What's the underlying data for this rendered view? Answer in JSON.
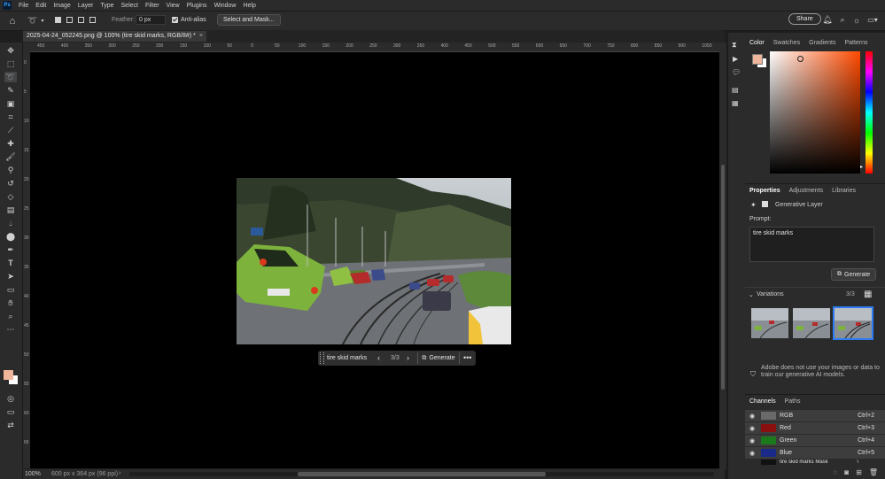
{
  "app": {
    "logo": "Ps"
  },
  "menu": [
    "File",
    "Edit",
    "Image",
    "Layer",
    "Type",
    "Select",
    "Filter",
    "View",
    "Plugins",
    "Window",
    "Help"
  ],
  "options": {
    "feather_label": "Feather:",
    "feather_value": "0 px",
    "antialias_label": "Anti-alias",
    "select_mask_label": "Select and Mask...",
    "share_label": "Share"
  },
  "document": {
    "tab_title": "2025-04-24_052245.png @ 100% (tire skid marks, RGB/8#) *",
    "zoom": "100%",
    "doc_info": "600 px x 364 px (96 ppi)"
  },
  "ruler": {
    "h_ticks": [
      "450",
      "400",
      "350",
      "300",
      "250",
      "200",
      "150",
      "100",
      "50",
      "0",
      "50",
      "100",
      "150",
      "200",
      "250",
      "300",
      "350",
      "400",
      "450",
      "500",
      "550",
      "600",
      "650",
      "700",
      "750",
      "800",
      "850",
      "900",
      "1050"
    ],
    "v_ticks": [
      "0",
      "5",
      "10",
      "15",
      "20",
      "25",
      "30",
      "35",
      "40",
      "45",
      "50",
      "55",
      "60",
      "65"
    ]
  },
  "context_bar": {
    "prompt": "tire skid marks",
    "counter": "3/3",
    "generate_label": "Generate"
  },
  "color_panel": {
    "tabs": [
      "Color",
      "Swatches",
      "Gradients",
      "Patterns"
    ],
    "fg_color": "#f0b69b",
    "bg_color": "#ffffff"
  },
  "properties_panel": {
    "tabs": [
      "Properties",
      "Adjustments",
      "Libraries"
    ],
    "layer_type": "Generative Layer",
    "prompt_label": "Prompt:",
    "prompt_value": "tire skid marks",
    "generate_label": "Generate",
    "variations_label": "Variations",
    "variations_counter": "3/3",
    "disclaimer": "Adobe does not use your images or data to train our generative AI models."
  },
  "channels_panel": {
    "tabs": [
      "Channels",
      "Paths"
    ],
    "rows": [
      {
        "name": "RGB",
        "shortcut": "Ctrl+2",
        "color": "#6a6a6a"
      },
      {
        "name": "Red",
        "shortcut": "Ctrl+3",
        "color": "#8a1010"
      },
      {
        "name": "Green",
        "shortcut": "Ctrl+4",
        "color": "#1b7a1b"
      },
      {
        "name": "Blue",
        "shortcut": "Ctrl+5",
        "color": "#1a2a8a"
      }
    ],
    "mask_row": "tire skid marks Mask",
    "mask_shortcut": "\\"
  },
  "colors": {
    "accent": "#2d7bf2",
    "selection": "#3d3d3d"
  }
}
